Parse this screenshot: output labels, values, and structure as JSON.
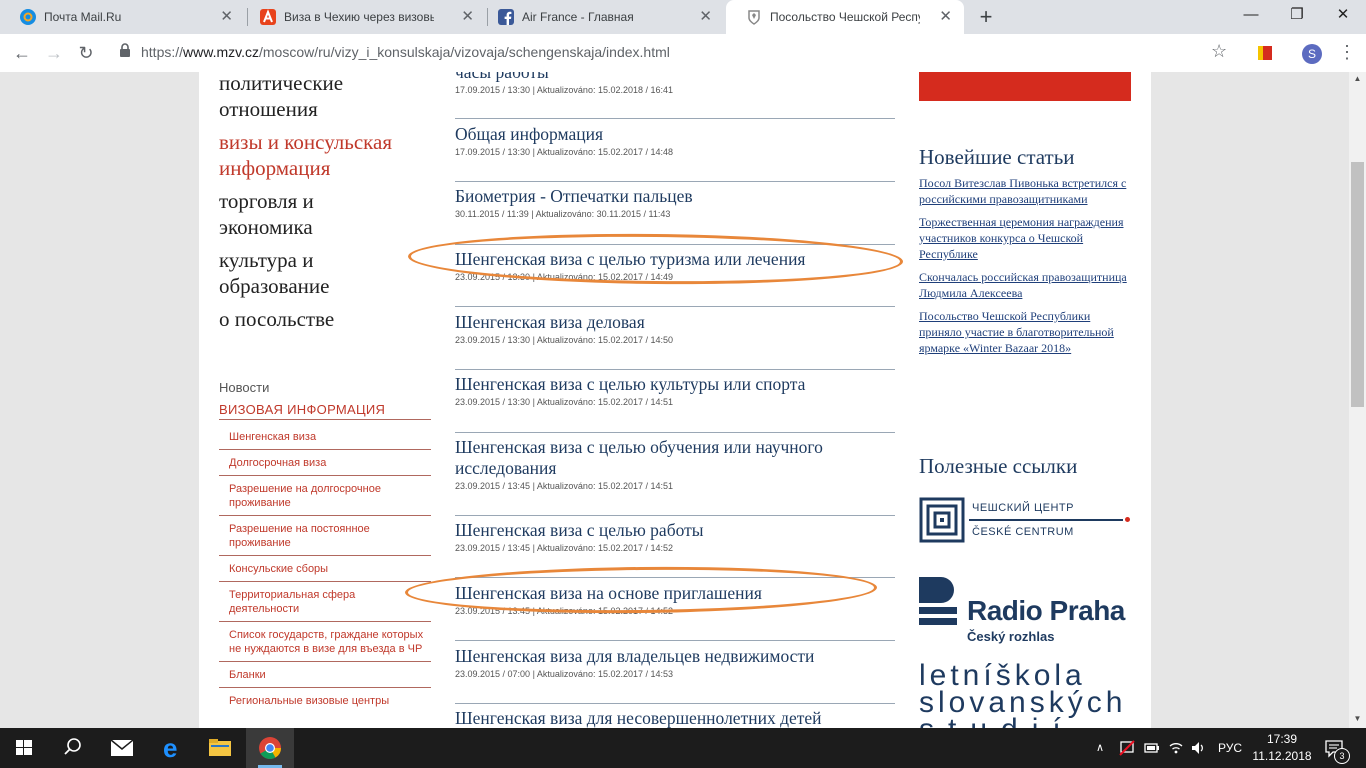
{
  "tabs": [
    {
      "label": "Почта Mail.Ru",
      "icon": "mail-ru-icon",
      "color": "#168de2"
    },
    {
      "label": "Виза в Чехию через визовый це",
      "icon": "ad-icon",
      "color": "#e8431c"
    },
    {
      "label": "Air France - Главная",
      "icon": "facebook-icon",
      "color": "#3b5998"
    },
    {
      "label": "Посольство Чешской Республи",
      "icon": "emblem-icon",
      "color": "#888888"
    }
  ],
  "address": {
    "scheme": "https://",
    "host": "www.mzv.cz",
    "path": "/moscow/ru/vizy_i_konsulskaja/vizovaja/schengenskaja/index.html"
  },
  "left_nav": {
    "main_items": [
      {
        "label": "политические отношения",
        "active": false
      },
      {
        "label": "визы и консульская информация",
        "active": true
      },
      {
        "label": "торговля и экономика",
        "active": false
      },
      {
        "label": "культура и образование",
        "active": false
      },
      {
        "label": "о посольстве",
        "active": false
      }
    ],
    "section_title": "Новости",
    "section_header": "ВИЗОВАЯ ИНФОРМАЦИЯ",
    "sub_items": [
      "Шенгенская виза",
      "Долгосрочная виза",
      "Разрешение на долгосрочное проживание",
      "Разрешение на постоянное проживание",
      "Консульские сборы",
      "Территориальная сфера деятельности",
      "Список государств, граждане которых не нуждаются в визе для въезда в ЧР",
      "Бланки",
      "Региональные визовые центры"
    ]
  },
  "articles": [
    {
      "title": "часы работы",
      "meta": "17.09.2015 / 13:30 | Aktualizováno: 15.02.2018 / 16:41"
    },
    {
      "title": "Общая информация",
      "meta": "17.09.2015 / 13:30 | Aktualizováno: 15.02.2017 / 14:48"
    },
    {
      "title": "Биометрия - Отпечатки пальцев",
      "meta": "30.11.2015 / 11:39 | Aktualizováno: 30.11.2015 / 11:43"
    },
    {
      "title": "Шенгенская виза с целью туризма или лечения",
      "meta": "23.09.2015 / 13:30 | Aktualizováno: 15.02.2017 / 14:49",
      "highlighted": true
    },
    {
      "title": "Шенгенская виза деловая",
      "meta": "23.09.2015 / 13:30 | Aktualizováno: 15.02.2017 / 14:50"
    },
    {
      "title": "Шенгенская виза с целью культуры или спорта",
      "meta": "23.09.2015 / 13:30 | Aktualizováno: 15.02.2017 / 14:51"
    },
    {
      "title": "Шенгенская виза с целью обучения или научного исследования",
      "meta": "23.09.2015 / 13:45 | Aktualizováno: 15.02.2017 / 14:51"
    },
    {
      "title": "Шенгенская виза с целью работы",
      "meta": "23.09.2015 / 13:45 | Aktualizováno: 15.02.2017 / 14:52"
    },
    {
      "title": "Шенгенская виза на основе приглашения",
      "meta": "23.09.2015 / 13:45 | Aktualizováno: 15.02.2017 / 14:52",
      "highlighted": true
    },
    {
      "title": "Шенгенская виза для владельцев недвижимости",
      "meta": "23.09.2015 / 07:00 | Aktualizováno: 15.02.2017 / 14:53"
    },
    {
      "title": "Шенгенская виза для несовершеннолетних детей",
      "meta": ""
    }
  ],
  "right": {
    "news_title": "Новейшие статьи",
    "news": [
      "Посол Витезслав Пивонька встретился с российскими правозащитниками",
      "Торжественная церемония награждения участников конкурса о Чешской Республике",
      "Скончалась российская правозащитница Людмила Алексеева",
      "Посольство Чешской Республики приняло участие в благотворительной ярмарке «Winter Bazaar 2018»"
    ],
    "links_title": "Полезные ссылки",
    "czech_center": {
      "line1": "ЧЕШСКИЙ ЦЕНТР",
      "line2": "ČESKÉ CENTRUM"
    },
    "radio": {
      "name": "Radio Praha",
      "sub": "Český rozhlas"
    },
    "school": {
      "line1": "letníškola",
      "line2": "slovanských",
      "line3": "studií"
    }
  },
  "taskbar": {
    "lang": "РУС",
    "time": "17:39",
    "date": "11.12.2018",
    "notifications": "3"
  },
  "colors": {
    "accent_red": "#c0392b",
    "link_blue": "#1e3a5f",
    "annotation": "#e8873a",
    "banner_red": "#d52b1e"
  }
}
